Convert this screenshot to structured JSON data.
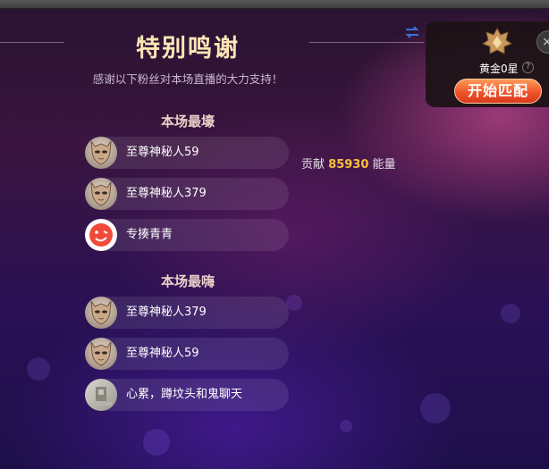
{
  "header": {
    "title": "特别鸣谢",
    "subtitle": "感谢以下粉丝对本场直播的大力支持！"
  },
  "sections": [
    {
      "title": "本场最壕",
      "rows": [
        {
          "name": "至尊神秘人59",
          "avatar": "mask-avatar"
        },
        {
          "name": "至尊神秘人379",
          "avatar": "mask-avatar"
        },
        {
          "name": "专揍青青",
          "avatar": "red-face-avatar"
        }
      ]
    },
    {
      "title": "本场最嗨",
      "rows": [
        {
          "name": "至尊神秘人379",
          "avatar": "mask-avatar"
        },
        {
          "name": "至尊神秘人59",
          "avatar": "mask-avatar"
        },
        {
          "name": "心累，蹲坟头和鬼聊天",
          "avatar": "photo-avatar"
        }
      ]
    }
  ],
  "contribution": {
    "prefix": "贡献",
    "value": "85930",
    "suffix": "能量"
  },
  "rank_panel": {
    "rank_label": "黄金0星",
    "help": "?",
    "match_button": "开始匹配",
    "close": "×"
  },
  "colors": {
    "title": "#ffe6b8",
    "accent": "#f7c23a",
    "button": "#f0552a"
  },
  "icons": [
    "swap-icon",
    "rank-badge-icon",
    "help-icon",
    "close-icon"
  ]
}
